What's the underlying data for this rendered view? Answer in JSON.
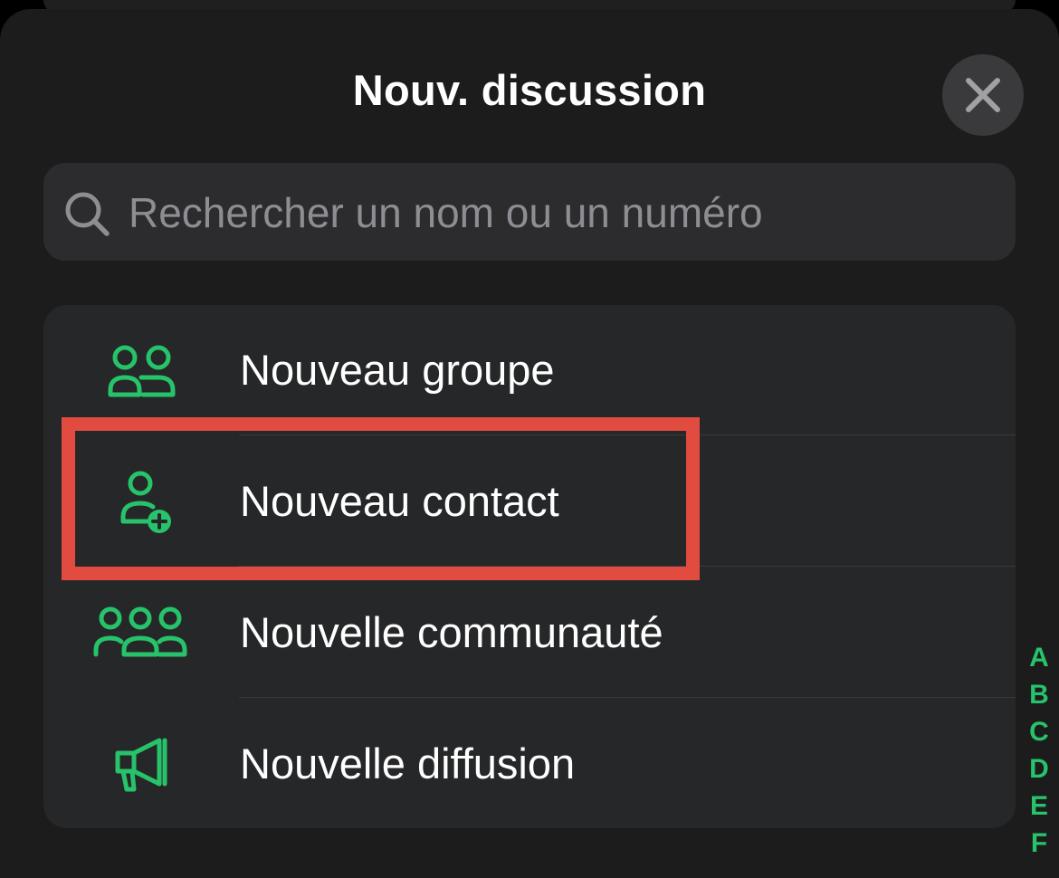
{
  "header": {
    "title": "Nouv. discussion",
    "close_icon": "close-icon"
  },
  "search": {
    "placeholder": "Rechercher un nom ou un numéro",
    "value": "",
    "icon": "search-icon"
  },
  "menu": {
    "items": [
      {
        "label": "Nouveau groupe",
        "icon": "group-icon"
      },
      {
        "label": "Nouveau contact",
        "icon": "add-contact-icon"
      },
      {
        "label": "Nouvelle communauté",
        "icon": "community-icon"
      },
      {
        "label": "Nouvelle diffusion",
        "icon": "megaphone-icon"
      }
    ]
  },
  "index": {
    "letters": [
      "A",
      "B",
      "C",
      "D",
      "E",
      "F"
    ]
  },
  "colors": {
    "accent": "#27c36a",
    "highlight": "#e24b40",
    "background": "#1c1c1d",
    "card": "#262728",
    "text": "#ffffff",
    "muted": "#8d8d93"
  }
}
